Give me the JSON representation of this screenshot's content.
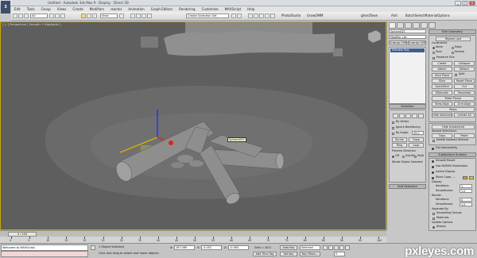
{
  "window": {
    "title": "Untitled - Autodesk 3ds Max 9 - Display : Direct 3D",
    "controls": [
      "_",
      "□",
      "×"
    ]
  },
  "app_logo": "3",
  "menu": [
    "Edit",
    "Tools",
    "Group",
    "Views",
    "Create",
    "Modifiers",
    "reactor",
    "Animation",
    "Graph Editors",
    "Rendering",
    "Customize",
    "MAXScript",
    "Help"
  ],
  "toolbar": {
    "selection_filter": "All",
    "reference_coord": "View",
    "named_selection": "Create Selection Set",
    "right_labels": [
      "PhotoStudio",
      "GrowOMM",
      "ghostTown",
      "Anti",
      "BatchSelect",
      "MaterialOptions"
    ]
  },
  "viewport": {
    "label": "[ + ] Perspective [ Smooth + Highlights ]",
    "tooltip": "Sphere003"
  },
  "command_panel": {
    "object_name": "Sphere003",
    "modifier_list": "Modifier List",
    "stack_buttons": [
      "Unwrap UVW",
      "Unwrap UVW"
    ],
    "stack_items": [
      {
        "label": "Editable Poly",
        "selected": true
      }
    ],
    "edit_geometry_title": "Edit Geometry",
    "repeat_last": "Repeat Last",
    "constraints_label": "Constraints",
    "constraint_options": [
      "None",
      "Edge",
      "Face",
      "Normal"
    ],
    "preserve_uvs": "Preserve UVs",
    "create_label": "Create",
    "collapse_label": "Collapse",
    "attach_label": "Attach",
    "detach_label": "Detach",
    "slice_plane": "Slice Plane",
    "split": "Split",
    "slice": "Slice",
    "reset_plane": "Reset Plane",
    "quickslice": "QuickSlice",
    "cut": "Cut",
    "msmooth": "MSmooth",
    "tessellate": "Tessellate",
    "make_planar": "Make Planar",
    "view_align": "View Align",
    "grid_align": "Grid Align",
    "relax": "Relax",
    "hide_selected": "Hide Selected",
    "unhide_all": "Unhide All",
    "hide_unselected": "Hide Unselected",
    "named_selections": "Named Selections:",
    "copy": "Copy",
    "paste": "Paste",
    "delete_isolated": "Delete Isolated Vertices",
    "full_interactivity": "Full Interactivity",
    "subdivision_title": "Subdivision Surface",
    "smooth_result": "Smooth Result",
    "use_nurms": "Use NURMS Subdivision",
    "isoline_display": "Isoline Display",
    "show_cage": "Show Cage......",
    "display_label": "Display",
    "iterations_label": "Iterations:",
    "iterations_value": "1",
    "smoothness_label": "Smoothness:",
    "smoothness_value": "1.0",
    "render_label": "Render",
    "render_iterations": "0",
    "render_smoothness": "1.0",
    "separate_by": "Separate By",
    "smoothing_groups": "Smoothing Groups",
    "materials": "Materials",
    "update_options": "Update Options",
    "always": "Always",
    "when_rendering": "When Rendering",
    "manually": "Manually",
    "update": "Update",
    "selection_title": "Selection",
    "by_vertex": "By Vertex",
    "ignore_backfacing": "Ignore Backfacing",
    "by_angle": "By Angle:",
    "by_angle_value": "45.0",
    "shrink": "Shrink",
    "grow": "Grow",
    "ring": "Ring",
    "loop": "Loop",
    "preview_selection": "Preview Selection",
    "preview_options": [
      "Off",
      "SubObj",
      "Multi"
    ],
    "whole_object": "Whole Object Selected",
    "soft_selection": "Soft Selection",
    "subdivision_displacement": "Subdivision Displacement",
    "paint_deformation": "Paint Deformation"
  },
  "timeline": {
    "slider": "0 / 100",
    "ticks": [
      "0",
      "5",
      "10",
      "15",
      "20",
      "25",
      "30",
      "35",
      "40",
      "45",
      "50",
      "55",
      "60",
      "65",
      "70",
      "75",
      "80",
      "85",
      "90",
      "95",
      "100"
    ]
  },
  "status": {
    "listener": "Welcome to MAXScript.",
    "selected": "1 Object Selected",
    "prompt": "Click and drag to select and move objects",
    "x_label": "X:",
    "x": "167.069",
    "y_label": "Y:",
    "y": "-4.052",
    "z_label": "Z:",
    "z": "-0.063",
    "grid": "Grid = 10.0",
    "add_time_tag": "Add Time Tag",
    "auto_key": "Auto Key",
    "set_key": "Set Key",
    "selected_dd": "Selected",
    "key_filters": "Key Filters...",
    "frame": "0"
  },
  "watermark": "pxleyes.com"
}
